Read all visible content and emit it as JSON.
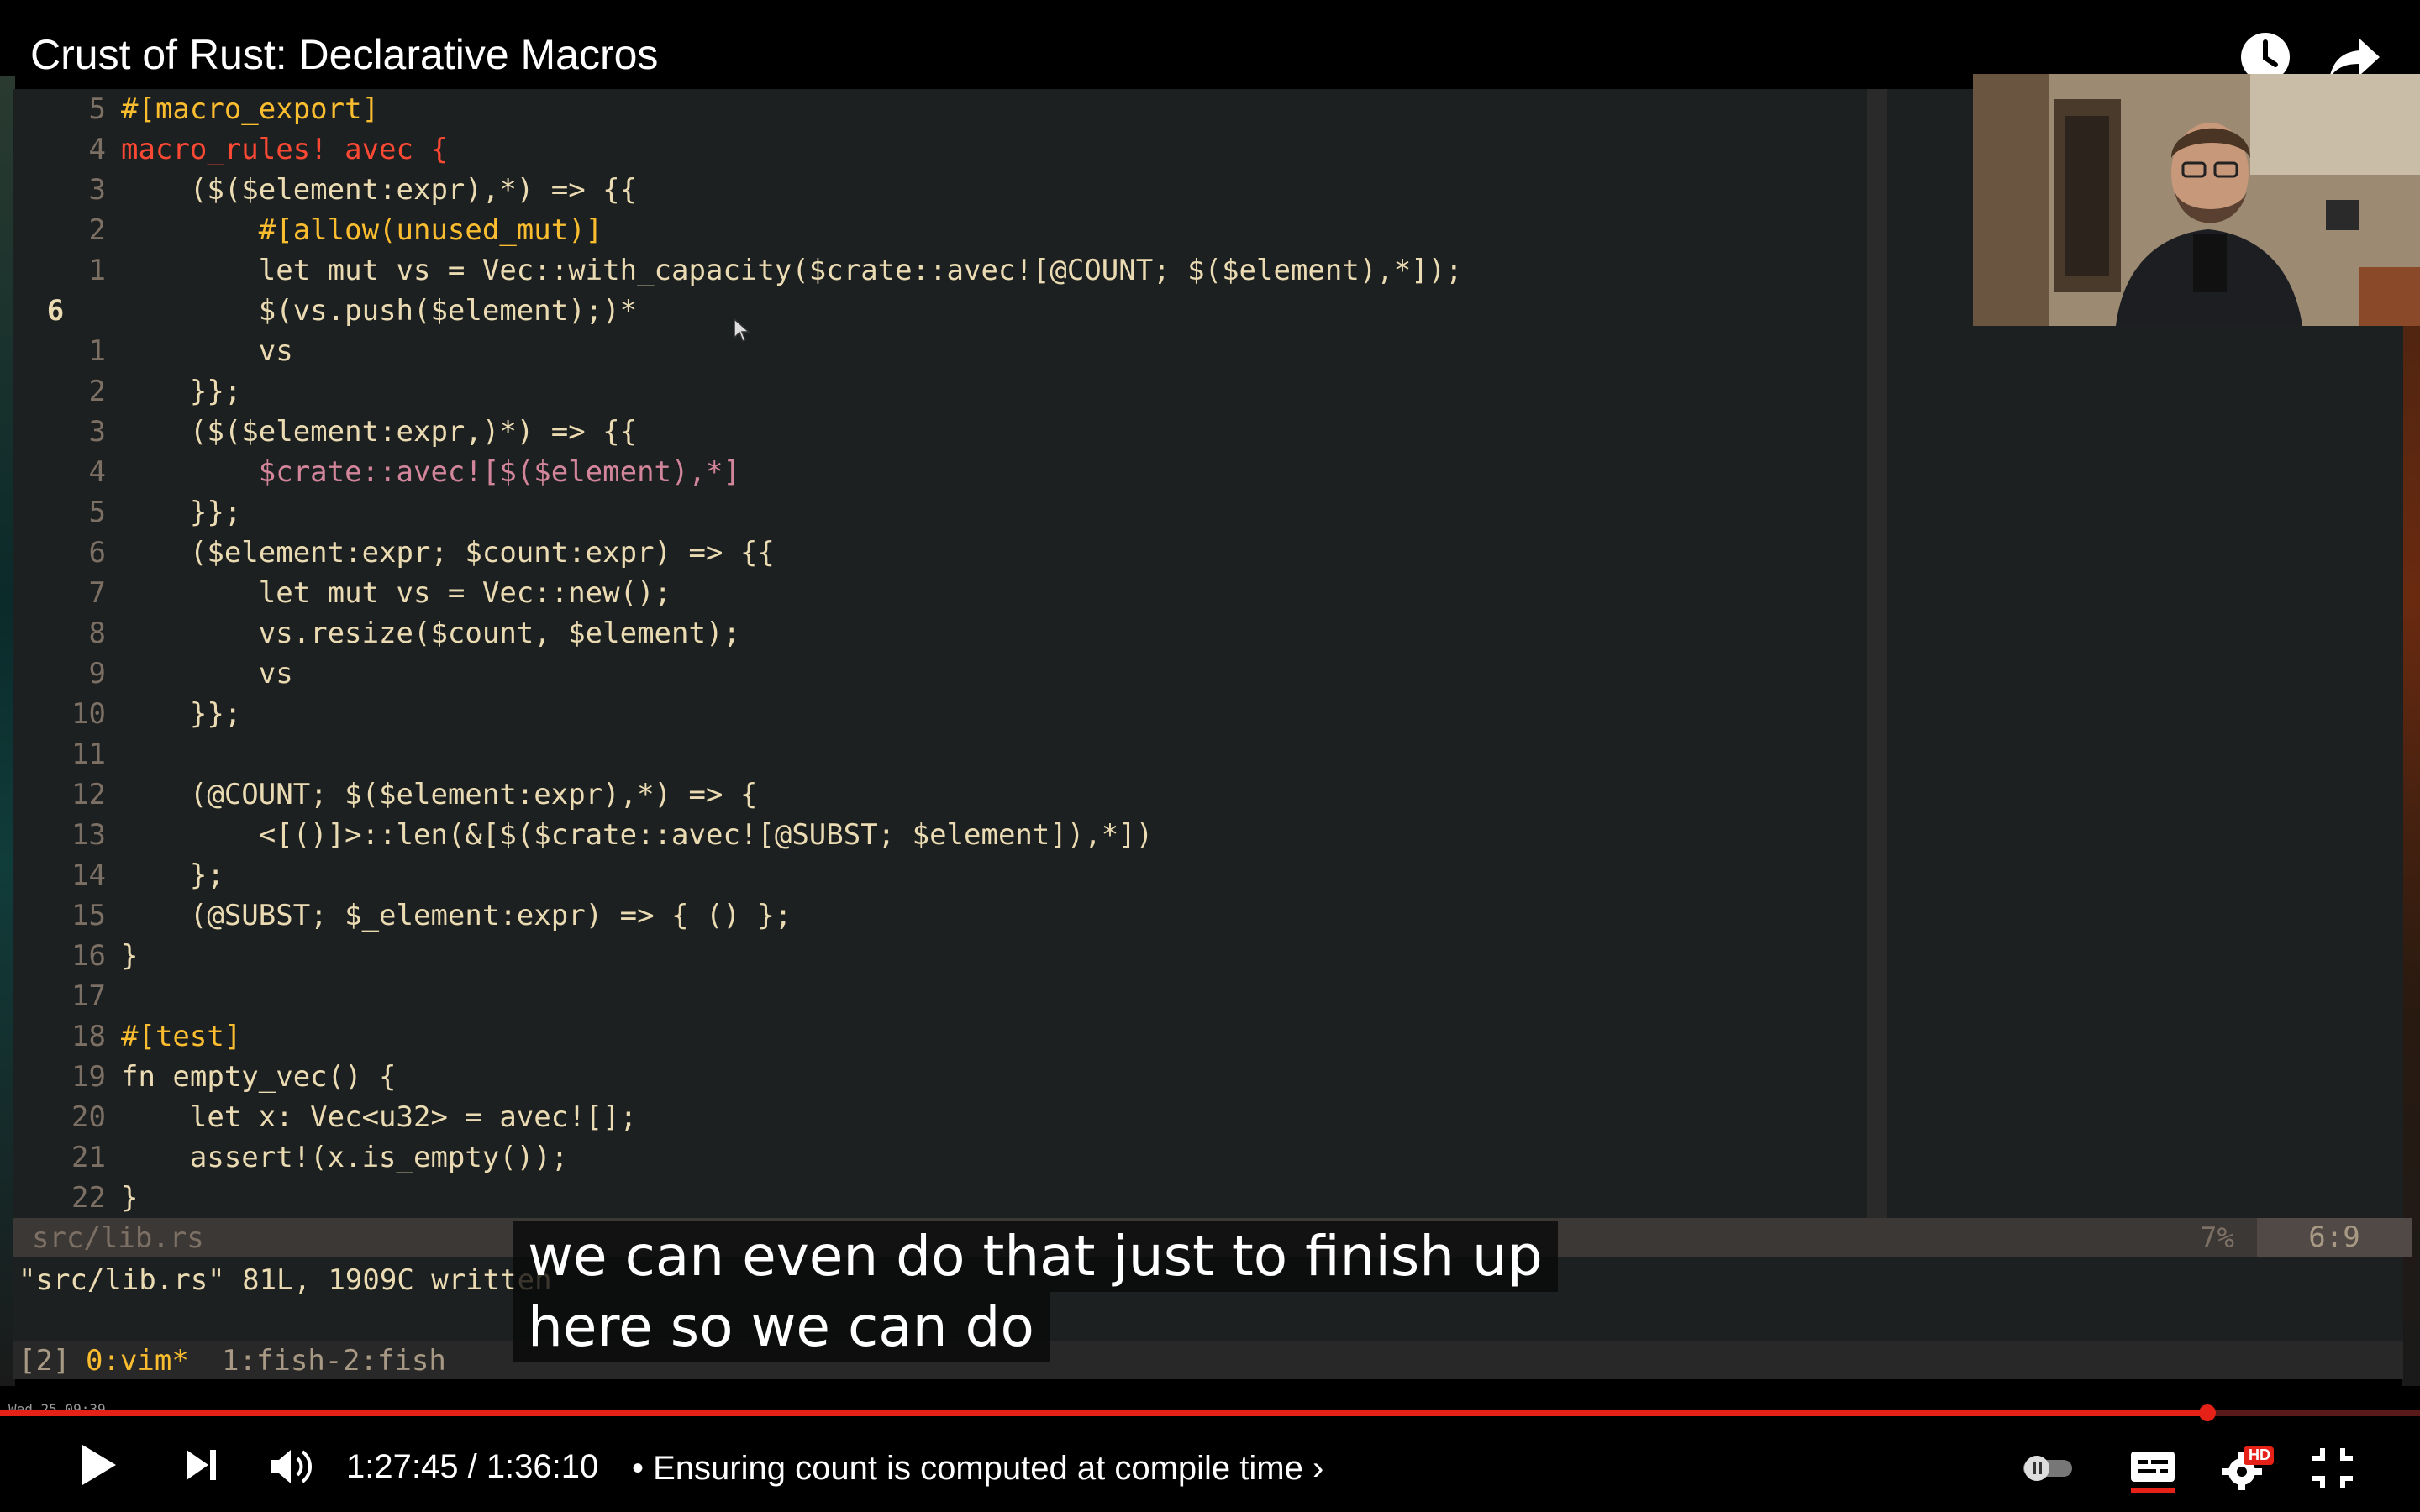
{
  "video": {
    "title": "Crust of Rust: Declarative Macros",
    "time_current": "1:27:45",
    "time_total": "1:36:10",
    "time_sep": " / ",
    "chapter": "• Ensuring count is computed at compile time ›",
    "progress": 0.912,
    "quality_badge": "HD"
  },
  "icons": {
    "watch_later": "clock-icon",
    "share": "share-arrow-icon",
    "play": "play-icon",
    "next": "skip-next-icon",
    "volume": "volume-icon",
    "autoplay": "autoplay-toggle-icon",
    "captions": "captions-icon",
    "settings": "gear-icon",
    "fullscreen_exit": "fullscreen-exit-icon"
  },
  "editor": {
    "lines": [
      {
        "n": "5",
        "t": "#[macro_export]"
      },
      {
        "n": "4",
        "t": "macro_rules! avec {"
      },
      {
        "n": "3",
        "t": "    ($($element:expr),*) => {{"
      },
      {
        "n": "2",
        "t": "        #[allow(unused_mut)]"
      },
      {
        "n": "1",
        "t": "        let mut vs = Vec::with_capacity($crate::avec![@COUNT; $($element),*]);"
      },
      {
        "n": "6",
        "t": "        $(vs.push($element);)*"
      },
      {
        "n": "1",
        "t": "        vs"
      },
      {
        "n": "2",
        "t": "    }};"
      },
      {
        "n": "3",
        "t": "    ($($element:expr,)*) => {{"
      },
      {
        "n": "4",
        "t": "        $crate::avec![$($element),*]"
      },
      {
        "n": "5",
        "t": "    }};"
      },
      {
        "n": "6",
        "t": "    ($element:expr; $count:expr) => {{"
      },
      {
        "n": "7",
        "t": "        let mut vs = Vec::new();"
      },
      {
        "n": "8",
        "t": "        vs.resize($count, $element);"
      },
      {
        "n": "9",
        "t": "        vs"
      },
      {
        "n": "10",
        "t": "    }};"
      },
      {
        "n": "11",
        "t": ""
      },
      {
        "n": "12",
        "t": "    (@COUNT; $($element:expr),*) => {"
      },
      {
        "n": "13",
        "t": "        <[()]>::len(&[$($crate::avec![@SUBST; $element]),*])"
      },
      {
        "n": "14",
        "t": "    };"
      },
      {
        "n": "15",
        "t": "    (@SUBST; $_element:expr) => { () };"
      },
      {
        "n": "16",
        "t": "}"
      },
      {
        "n": "17",
        "t": ""
      },
      {
        "n": "18",
        "t": "#[test]"
      },
      {
        "n": "19",
        "t": "fn empty_vec() {"
      },
      {
        "n": "20",
        "t": "    let x: Vec<u32> = avec![];"
      },
      {
        "n": "21",
        "t": "    assert!(x.is_empty());"
      },
      {
        "n": "22",
        "t": "}"
      }
    ],
    "status_file": "src/lib.rs",
    "status_pct": "7%",
    "status_pos": "6:9",
    "cmd_message": "\"src/lib.rs\" 81L, 1909C written",
    "tmux": {
      "session": "[2]",
      "win0": "0:vim*",
      "win1": "1:fish-",
      "win2": "2:fish"
    }
  },
  "subtitles": {
    "line1": "we can even do that just to finish up",
    "line2": "here so we can do"
  },
  "dock_text": "Wed 25 09:39",
  "colors": {
    "accent": "#e62117",
    "editor_bg": "#1d2021"
  }
}
